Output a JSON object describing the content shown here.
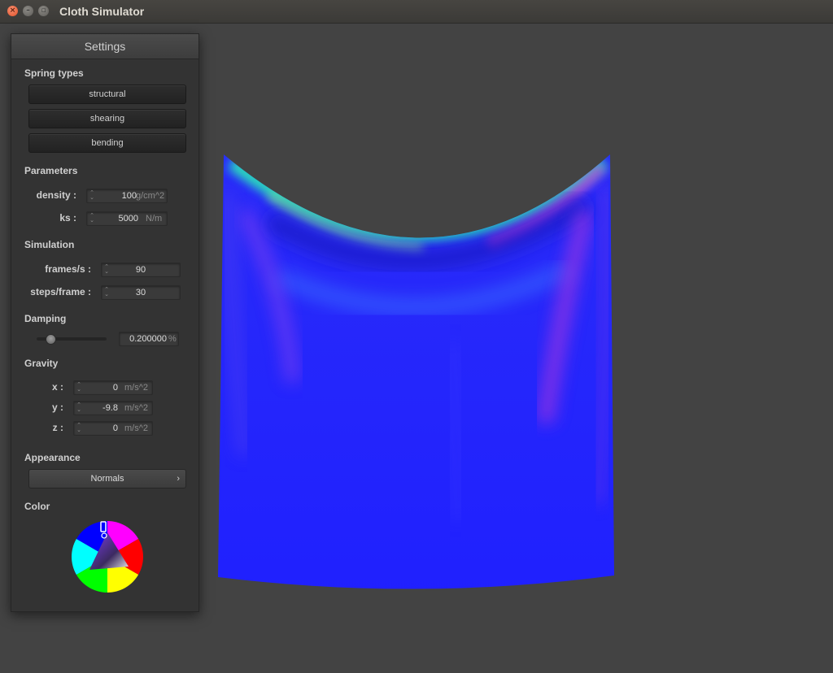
{
  "window": {
    "title": "Cloth Simulator"
  },
  "settings": {
    "header": "Settings",
    "spring_types": {
      "heading": "Spring types",
      "buttons": [
        "structural",
        "shearing",
        "bending"
      ]
    },
    "parameters": {
      "heading": "Parameters",
      "density": {
        "label": "density :",
        "value": "100",
        "unit": "g/cm^2"
      },
      "ks": {
        "label": "ks :",
        "value": "5000",
        "unit": "N/m"
      }
    },
    "simulation": {
      "heading": "Simulation",
      "frames_per_s": {
        "label": "frames/s :",
        "value": "90"
      },
      "steps_per_frame": {
        "label": "steps/frame :",
        "value": "30"
      }
    },
    "damping": {
      "heading": "Damping",
      "value": "0.200000",
      "unit": "%",
      "slider_level": 0.2
    },
    "gravity": {
      "heading": "Gravity",
      "x": {
        "label": "x :",
        "value": "0",
        "unit": "m/s^2"
      },
      "y": {
        "label": "y :",
        "value": "-9.8",
        "unit": "m/s^2"
      },
      "z": {
        "label": "z :",
        "value": "0",
        "unit": "m/s^2"
      }
    },
    "appearance": {
      "heading": "Appearance",
      "selected": "Normals"
    },
    "color": {
      "heading": "Color",
      "selected_color": "#7a3cf0"
    }
  },
  "colors": {
    "cloth_base": "#2424ff",
    "background": "#434343",
    "panel": "#333333"
  }
}
